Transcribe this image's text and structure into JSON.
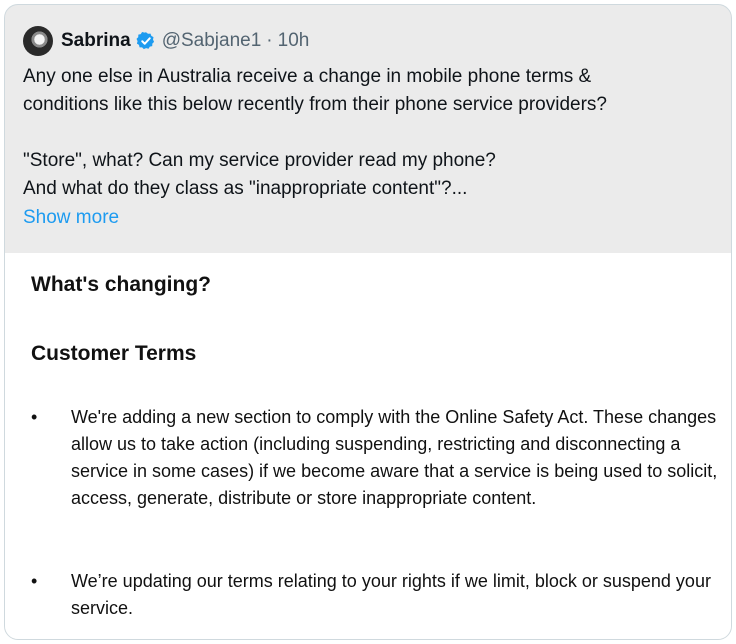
{
  "tweet": {
    "author_name": "Sabrina",
    "handle": "@Sabjane1",
    "separator": "·",
    "time": "10h",
    "text": "Any one else in Australia receive a change in mobile phone terms &\nconditions like this below recently from their phone service providers?\n\n\"Store\", what? Can my service provider read my phone?\nAnd what do they class as \"inappropriate content\"?...",
    "show_more": "Show more",
    "icons": {
      "avatar": "avatar",
      "verified": "verified-badge-icon"
    },
    "colors": {
      "accent": "#1d9bf0",
      "secondary_text": "#536471",
      "card_background": "#ebebeb"
    }
  },
  "media": {
    "heading": "What's changing?",
    "subheading": "Customer Terms",
    "bullet_symbol": "•",
    "bullets": [
      "We're adding a new section to comply with the Online Safety Act. These changes allow us to take action (including suspending, restricting and disconnecting a service in some cases) if we become aware that a service is being used to solicit, access, generate, distribute or store inappropriate content.",
      "We’re updating our terms relating to your rights if we limit, block or suspend your service."
    ]
  }
}
